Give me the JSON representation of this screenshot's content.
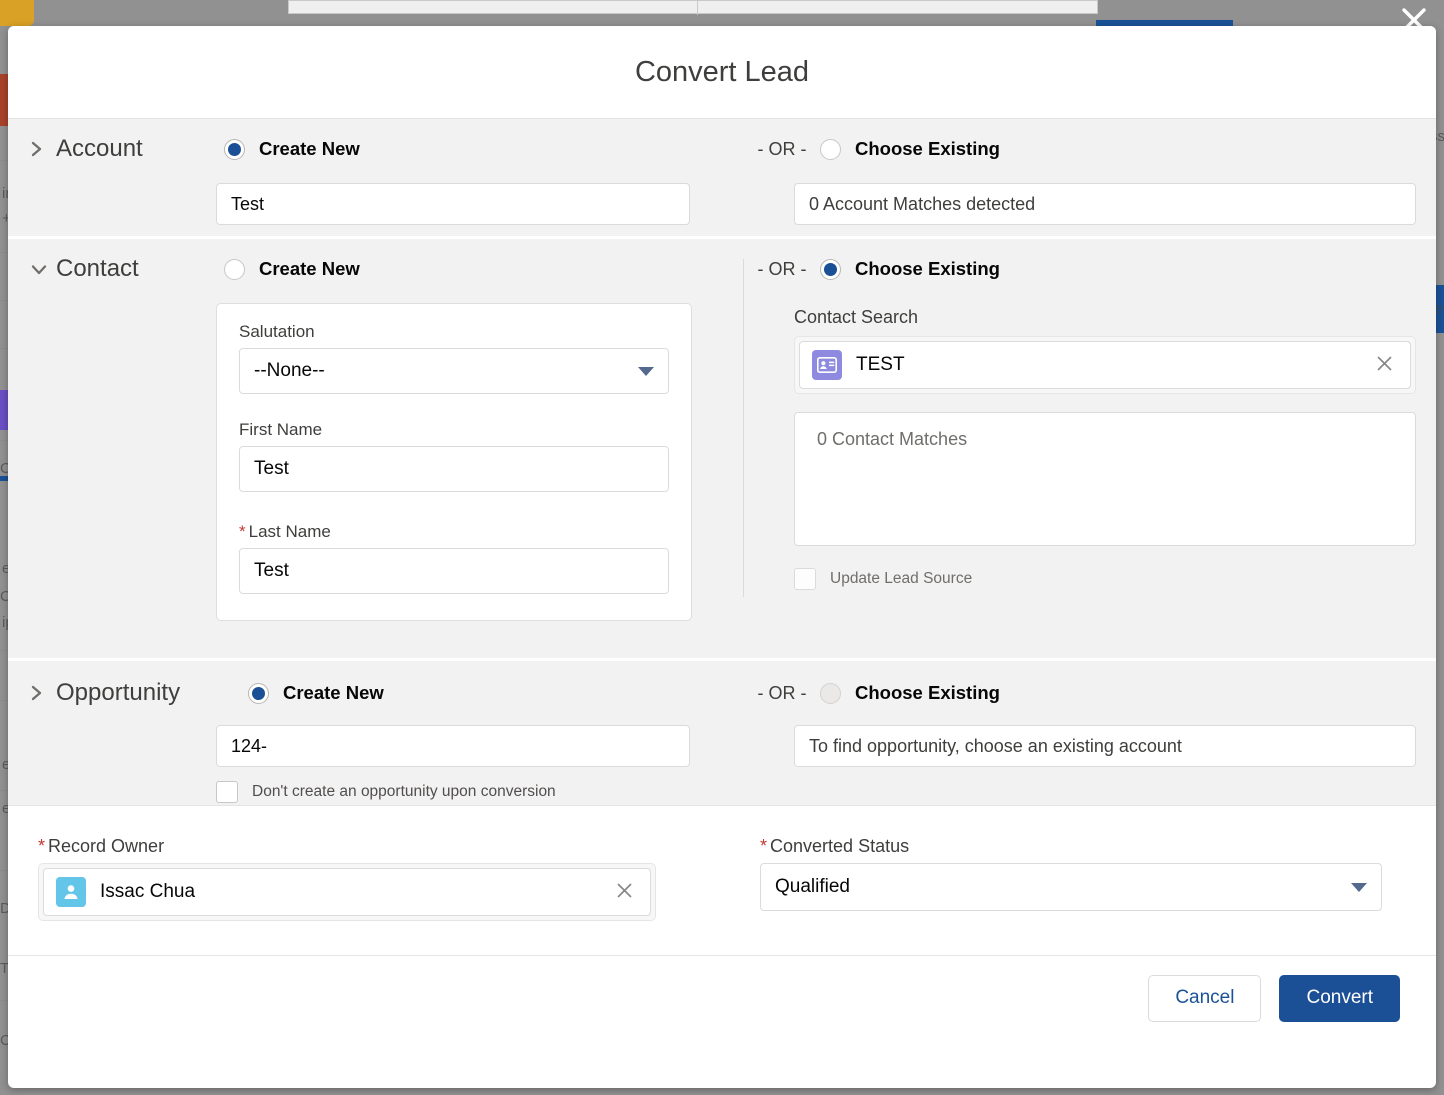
{
  "modal": {
    "title": "Convert Lead",
    "close_icon": "close-icon"
  },
  "labels": {
    "or": "- OR -",
    "create_new": "Create New",
    "choose_existing": "Choose Existing"
  },
  "account": {
    "section_title": "Account",
    "chevron": "chevron-right-icon",
    "create_new_label": "Create New",
    "create_new_selected": true,
    "name_value": "Test",
    "or": "- OR -",
    "choose_existing_label": "Choose Existing",
    "choose_existing_selected": false,
    "matches_text": "0 Account Matches detected"
  },
  "contact": {
    "section_title": "Contact",
    "chevron": "chevron-down-icon",
    "create_new_label": "Create New",
    "create_new_selected": false,
    "or": "- OR -",
    "choose_existing_label": "Choose Existing",
    "choose_existing_selected": true,
    "fields": {
      "salutation_label": "Salutation",
      "salutation_value": "--None--",
      "first_name_label": "First Name",
      "first_name_value": "Test",
      "last_name_label": "Last Name",
      "last_name_required": "*",
      "last_name_value": "Test"
    },
    "search_label": "Contact Search",
    "search_pill_text": "TEST",
    "search_pill_icon": "contact-card-icon",
    "search_clear_icon": "clear-icon",
    "matches_text": "0 Contact Matches",
    "update_lead_source_label": "Update Lead Source",
    "update_lead_source_checked": false
  },
  "opportunity": {
    "section_title": "Opportunity",
    "chevron": "chevron-right-icon",
    "create_new_label": "Create New",
    "create_new_selected": true,
    "name_value": "124-",
    "or": "- OR -",
    "choose_existing_label": "Choose Existing",
    "choose_existing_selected": false,
    "existing_placeholder": "To find opportunity, choose an existing account",
    "dont_create_label": "Don't create an opportunity upon conversion",
    "dont_create_checked": false
  },
  "owner": {
    "record_owner_label": "Record Owner",
    "record_owner_required": "*",
    "record_owner_value": "Issac Chua",
    "record_owner_icon": "user-avatar-icon",
    "record_owner_clear_icon": "clear-icon",
    "converted_status_label": "Converted Status",
    "converted_status_required": "*",
    "converted_status_value": "Qualified"
  },
  "footer": {
    "cancel_label": "Cancel",
    "convert_label": "Convert"
  },
  "colors": {
    "brand_blue": "#1b4f96",
    "required_red": "#c23934",
    "contact_purple": "#8e8ae0",
    "user_blue": "#63c5e8",
    "backdrop": "#808080"
  },
  "background": {
    "fragments": [
      "in",
      "+",
      "C",
      "ij",
      "e",
      "Co",
      "ip",
      "e",
      "e",
      "De",
      "T",
      "Ca",
      "ss",
      "te"
    ]
  }
}
